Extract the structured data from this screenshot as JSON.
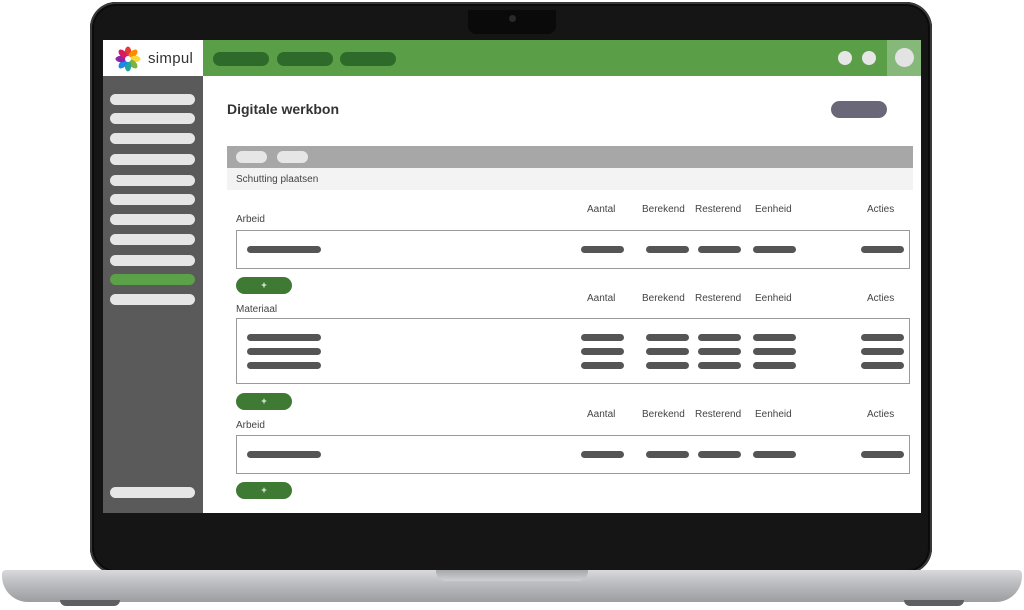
{
  "app": {
    "brand_name": "simpul",
    "colors": {
      "primary": "#5a9e47",
      "primary_dark": "#3f7a35",
      "sidebar": "#5a5a5a",
      "active_item": "#5aa147"
    }
  },
  "header": {
    "title": "Digitale werkbon"
  },
  "job": {
    "name": "Schutting plaatsen"
  },
  "columns": [
    "Aantal",
    "Berekend",
    "Resterend",
    "Eenheid",
    "Acties"
  ],
  "sections": [
    {
      "label": "Arbeid",
      "rows": 1,
      "add_label": "+"
    },
    {
      "label": "Materiaal",
      "rows": 3,
      "add_label": "+"
    },
    {
      "label": "Arbeid",
      "rows": 1,
      "add_label": "+"
    }
  ],
  "icons": {
    "logo": "simpul-flower-logo",
    "user": "avatar-icon"
  }
}
